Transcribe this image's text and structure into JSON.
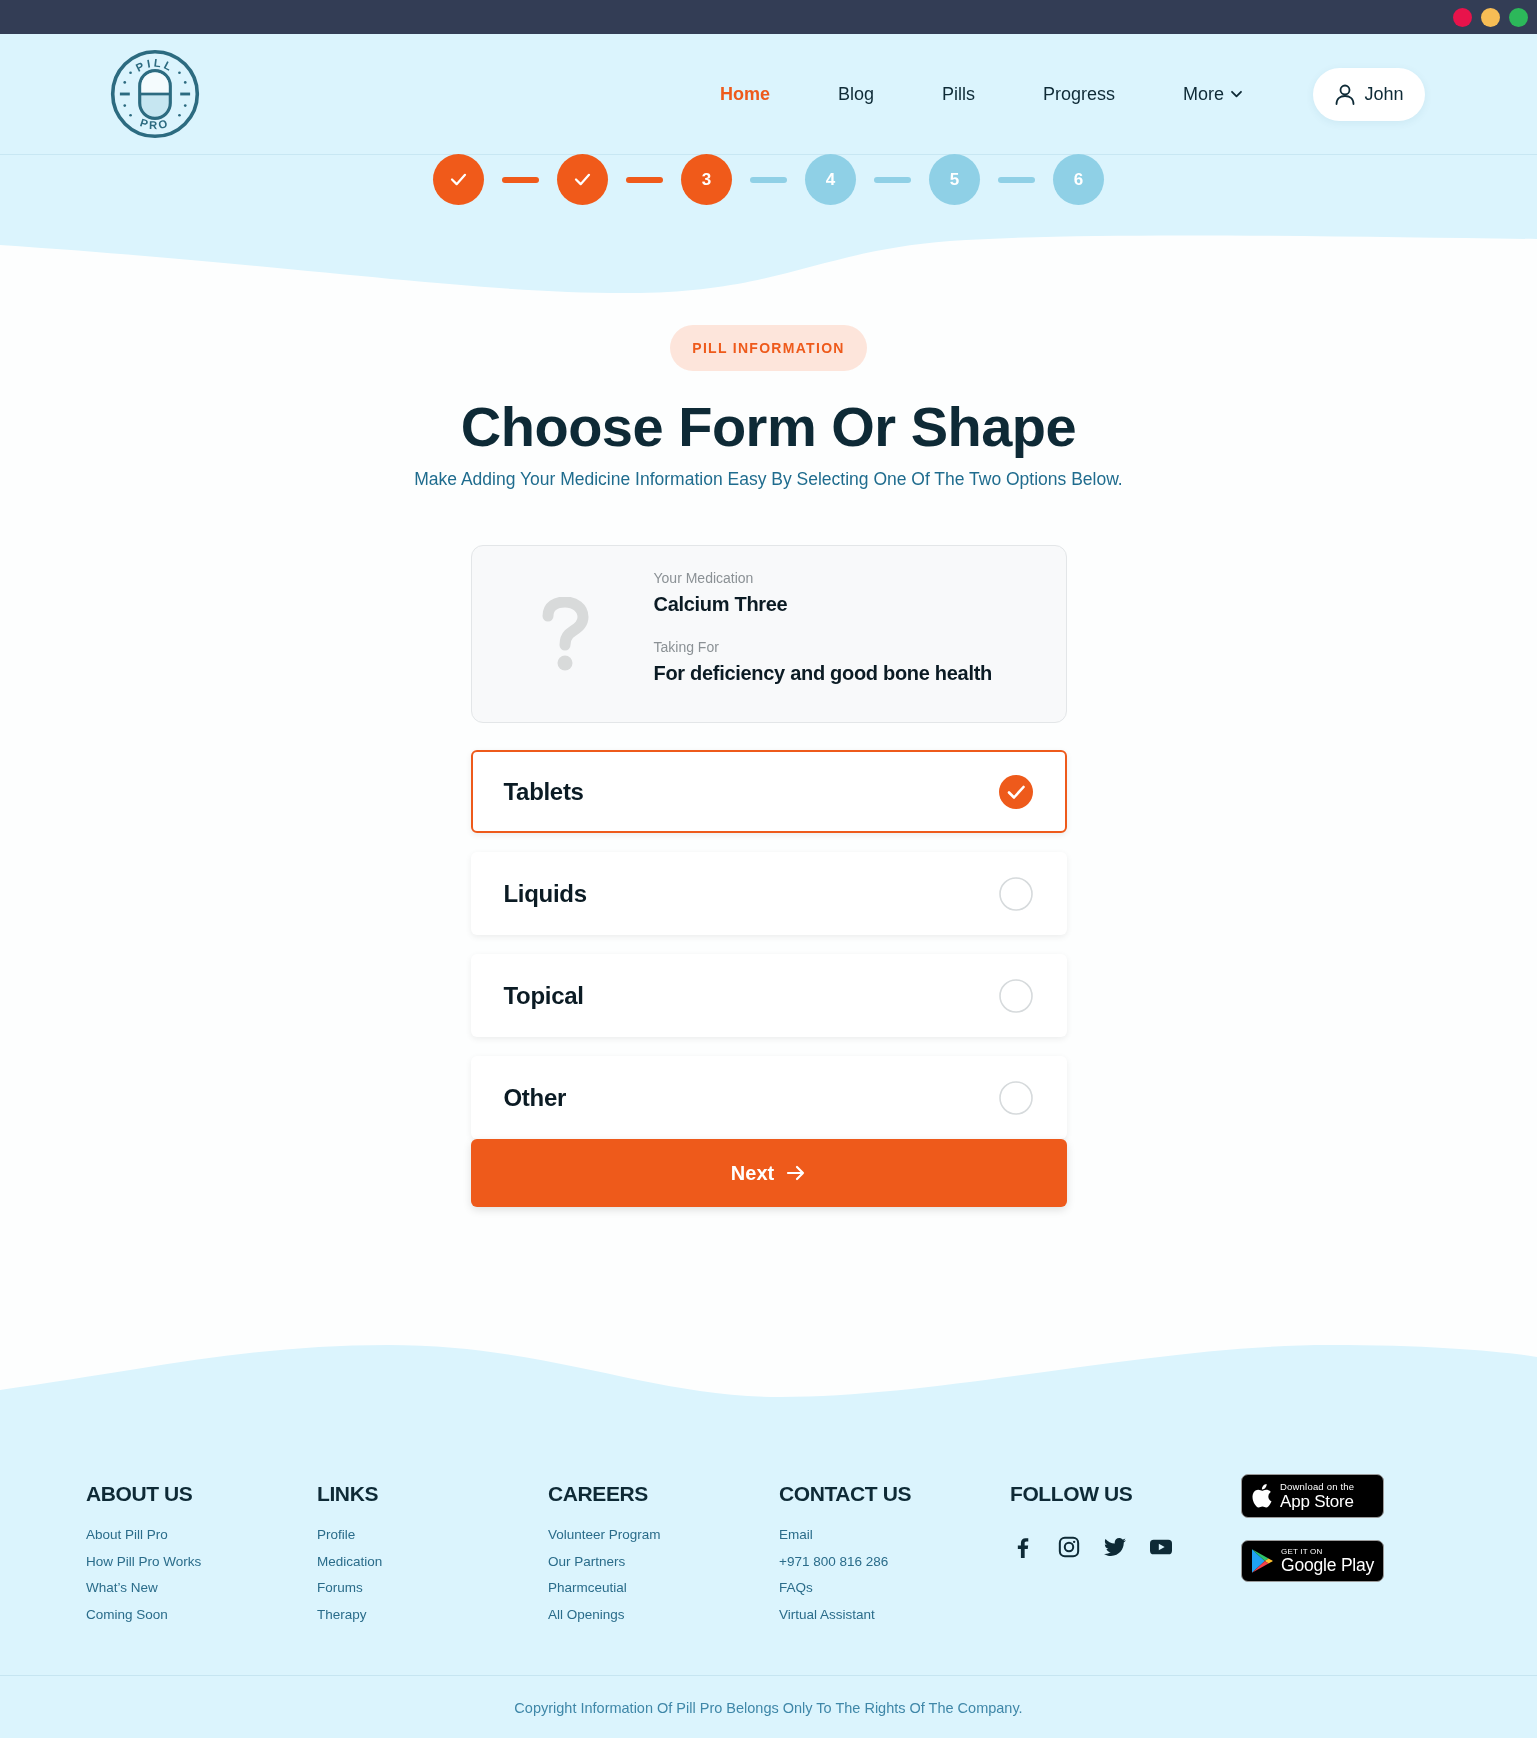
{
  "window": {
    "controls": [
      {
        "kind": "close",
        "color": "#e8134b"
      },
      {
        "kind": "minimize",
        "color": "#f7bd55"
      },
      {
        "kind": "maximize",
        "color": "#2cb85a"
      }
    ]
  },
  "header": {
    "logo": {
      "top_text": "PILL",
      "bottom_text": "PRO"
    },
    "nav": [
      {
        "label": "Home",
        "kind": "link",
        "selected": true
      },
      {
        "label": "Blog",
        "kind": "link",
        "selected": false
      },
      {
        "label": "Pills",
        "kind": "link",
        "selected": false
      },
      {
        "label": "Progress",
        "kind": "link",
        "selected": false
      },
      {
        "label": "More",
        "kind": "menu",
        "selected": false
      }
    ],
    "user_button": {
      "label": "John"
    }
  },
  "stepper": {
    "steps": [
      {
        "kind": "done"
      },
      {
        "kind": "done"
      },
      {
        "kind": "current",
        "label": "3"
      },
      {
        "kind": "upcoming",
        "label": "4"
      },
      {
        "kind": "upcoming",
        "label": "5"
      },
      {
        "kind": "upcoming",
        "label": "6"
      }
    ]
  },
  "section": {
    "tag": "PILL INFORMATION",
    "title": "Choose Form Or Shape",
    "subtitle": "Make Adding Your Medicine Information Easy By Selecting One Of The Two Options Below."
  },
  "medication": {
    "fields": [
      {
        "label": "Your Medication",
        "value": "Calcium Three"
      },
      {
        "label": "Taking For",
        "value": "For deficiency and good bone health"
      }
    ]
  },
  "options": [
    {
      "label": "Tablets",
      "selected": true
    },
    {
      "label": "Liquids",
      "selected": false
    },
    {
      "label": "Topical",
      "selected": false
    },
    {
      "label": "Other",
      "selected": false
    }
  ],
  "next_button": {
    "label": "Next"
  },
  "footer": {
    "columns": [
      {
        "heading": "ABOUT US",
        "links": [
          "About Pill Pro",
          "How Pill Pro Works",
          "What’s New",
          "Coming Soon"
        ]
      },
      {
        "heading": "LINKS",
        "links": [
          "Profile",
          "Medication",
          "Forums",
          "Therapy"
        ]
      },
      {
        "heading": "CAREERS",
        "links": [
          "Volunteer Program",
          "Our Partners",
          "Pharmceutial",
          "All Openings"
        ]
      },
      {
        "heading": "CONTACT US",
        "links": [
          "Email",
          "+971 800 816 286",
          "FAQs",
          "Virtual Assistant"
        ]
      }
    ],
    "follow": {
      "heading": "FOLLOW US",
      "icons": [
        {
          "kind": "facebook"
        },
        {
          "kind": "instagram"
        },
        {
          "kind": "twitter"
        },
        {
          "kind": "youtube"
        }
      ]
    },
    "stores": [
      {
        "kind": "apple",
        "caption": "Download on the",
        "name": "App Store"
      },
      {
        "kind": "google",
        "caption": "GET IT ON",
        "name": "Google Play"
      }
    ],
    "copyright": "Copyright Information Of Pill Pro Belongs Only To The Rights Of The Company."
  }
}
